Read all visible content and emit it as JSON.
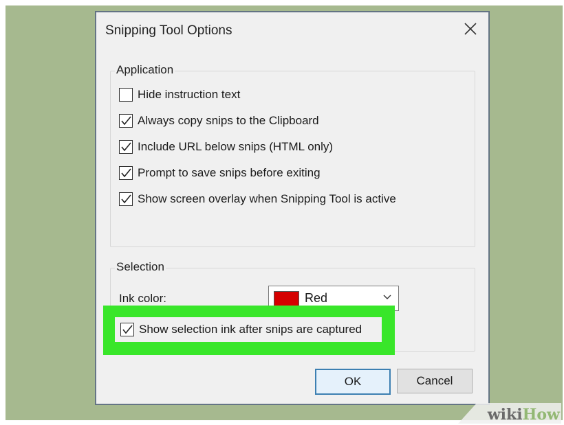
{
  "dialog": {
    "title": "Snipping Tool Options",
    "close_icon": "close-icon"
  },
  "application": {
    "label": "Application",
    "options": [
      {
        "label": "Hide instruction text",
        "checked": false
      },
      {
        "label": "Always copy snips to the Clipboard",
        "checked": true
      },
      {
        "label": "Include URL below snips (HTML only)",
        "checked": true
      },
      {
        "label": "Prompt to save snips before exiting",
        "checked": true
      },
      {
        "label": "Show screen overlay when Snipping Tool is active",
        "checked": true
      }
    ]
  },
  "selection": {
    "label": "Selection",
    "ink_color_label": "Ink color:",
    "ink_color_value": "Red",
    "ink_color_hex": "#d50000",
    "show_ink_option": {
      "label": "Show selection ink after snips are captured",
      "checked": true
    }
  },
  "buttons": {
    "ok": "OK",
    "cancel": "Cancel"
  },
  "watermark": {
    "wiki": "wiki",
    "how": "How"
  },
  "colors": {
    "backdrop": "#a6b98f",
    "highlight": "#39e62a",
    "ok_border": "#3c7fb1"
  }
}
